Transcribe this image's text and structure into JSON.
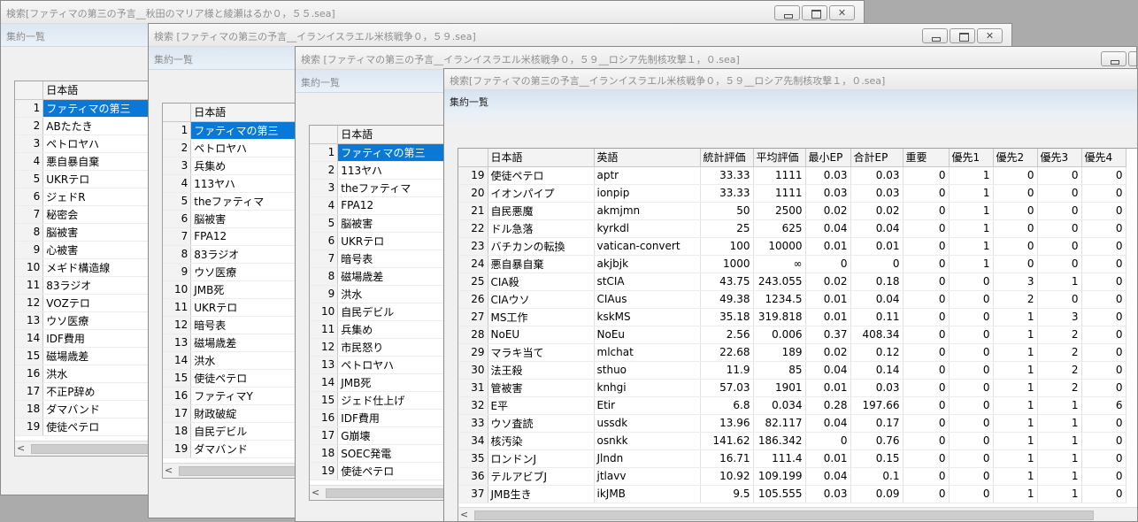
{
  "windows": {
    "w1": {
      "title": "検索[ファティマの第三の予言__秋田のマリア様と綾瀬はるか０，５５.sea]",
      "subtitle": "集約一覧"
    },
    "w2": {
      "title": "検索 [ファティマの第三の予言__イランイスラエル米核戦争０，５９.sea]",
      "subtitle": "集約一覧"
    },
    "w3": {
      "title": "検索 [ファティマの第三の予言__イランイスラエル米核戦争０，５９__ロシア先制核攻撃１，０.sea]",
      "subtitle": "集約一覧"
    },
    "w4": {
      "title": "検索[ファティマの第三の予言__イランイスラエル米核戦争０，５９__ロシア先制核攻撃１，０.sea]",
      "subtitle": "集約一覧"
    }
  },
  "grid1": {
    "header": "日本語",
    "rows": [
      "ファティマの第三",
      "ABたたき",
      "ペトロヤハ",
      "悪自暴自棄",
      "UKRテロ",
      "ジェドR",
      "秘密会",
      "脳被害",
      "心被害",
      "メギド構造線",
      "83ラジオ",
      "VOZテロ",
      "ウソ医療",
      "IDF費用",
      "磁場歳差",
      "洪水",
      "不正P辞め",
      "ダマバンド",
      "使徒ペテロ"
    ]
  },
  "grid2": {
    "header": "日本語",
    "rows": [
      "ファティマの第三",
      "ペトロヤハ",
      "兵集め",
      "113ヤハ",
      "theファティマ",
      "脳被害",
      "FPA12",
      "83ラジオ",
      "ウソ医療",
      "JMB死",
      "UKRテロ",
      "暗号表",
      "磁場歳差",
      "洪水",
      "使徒ペテロ",
      "ファティマY",
      "財政破綻",
      "自民デビル",
      "ダマバンド"
    ]
  },
  "grid3": {
    "header": "日本語",
    "rows": [
      "ファティマの第三",
      "113ヤハ",
      "theファティマ",
      "FPA12",
      "脳被害",
      "UKRテロ",
      "暗号表",
      "磁場歳差",
      "洪水",
      "自民デビル",
      "兵集め",
      "市民怒り",
      "ペトロヤハ",
      "JMB死",
      "ジェド仕上げ",
      "IDF費用",
      "G崩壊",
      "SOEC発電",
      "使徒ペテロ"
    ]
  },
  "grid4": {
    "headers": [
      "日本語",
      "英語",
      "統計評価",
      "平均評価",
      "最小EP",
      "合計EP",
      "重要",
      "優先1",
      "優先2",
      "優先3",
      "優先4"
    ],
    "rows": [
      [
        "19",
        "使徒ペテロ",
        "aptr",
        "33.33",
        "1111",
        "0.03",
        "0.03",
        "0",
        "1",
        "0",
        "0",
        "0"
      ],
      [
        "20",
        "イオンパイプ",
        "ionpip",
        "33.33",
        "1111",
        "0.03",
        "0.03",
        "0",
        "1",
        "0",
        "0",
        "0"
      ],
      [
        "21",
        "自民悪魔",
        "akmjmn",
        "50",
        "2500",
        "0.02",
        "0.02",
        "0",
        "1",
        "0",
        "0",
        "0"
      ],
      [
        "22",
        "ドル急落",
        "kyrkdl",
        "25",
        "625",
        "0.04",
        "0.04",
        "0",
        "1",
        "0",
        "0",
        "0"
      ],
      [
        "23",
        "バチカンの転換",
        "vatican-convert",
        "100",
        "10000",
        "0.01",
        "0.01",
        "0",
        "1",
        "0",
        "0",
        "0"
      ],
      [
        "24",
        "悪自暴自棄",
        "akjbjk",
        "1000",
        "∞",
        "0",
        "0",
        "0",
        "1",
        "0",
        "0",
        "0"
      ],
      [
        "25",
        "CIA殺",
        "stCIA",
        "43.75",
        "243.055",
        "0.02",
        "0.18",
        "0",
        "0",
        "3",
        "1",
        "0"
      ],
      [
        "26",
        "CIAウソ",
        "CIAus",
        "49.38",
        "1234.5",
        "0.01",
        "0.04",
        "0",
        "0",
        "2",
        "0",
        "0"
      ],
      [
        "27",
        "MS工作",
        "kskMS",
        "35.18",
        "319.818",
        "0.01",
        "0.11",
        "0",
        "0",
        "1",
        "3",
        "0"
      ],
      [
        "28",
        "NoEU",
        "NoEu",
        "2.56",
        "0.006",
        "0.37",
        "408.34",
        "0",
        "0",
        "1",
        "2",
        "0"
      ],
      [
        "29",
        "マラキ当て",
        "mlchat",
        "22.68",
        "189",
        "0.02",
        "0.12",
        "0",
        "0",
        "1",
        "2",
        "0"
      ],
      [
        "30",
        "法王殺",
        "sthuo",
        "11.9",
        "85",
        "0.04",
        "0.14",
        "0",
        "0",
        "1",
        "2",
        "0"
      ],
      [
        "31",
        "管被害",
        "knhgi",
        "57.03",
        "1901",
        "0.01",
        "0.03",
        "0",
        "0",
        "1",
        "2",
        "0"
      ],
      [
        "32",
        "E平",
        "Etir",
        "6.8",
        "0.034",
        "0.28",
        "197.66",
        "0",
        "0",
        "1",
        "1",
        "6"
      ],
      [
        "33",
        "ウソ査読",
        "ussdk",
        "13.96",
        "82.117",
        "0.04",
        "0.17",
        "0",
        "0",
        "1",
        "1",
        "0"
      ],
      [
        "34",
        "核汚染",
        "osnkk",
        "141.62",
        "186.342",
        "0",
        "0.76",
        "0",
        "0",
        "1",
        "1",
        "0"
      ],
      [
        "35",
        "ロンドンJ",
        "Jlndn",
        "16.71",
        "111.4",
        "0.01",
        "0.15",
        "0",
        "0",
        "1",
        "1",
        "0"
      ],
      [
        "36",
        "テルアビブJ",
        "jtlavv",
        "10.92",
        "109.199",
        "0.04",
        "0.1",
        "0",
        "0",
        "1",
        "1",
        "0"
      ],
      [
        "37",
        "JMB生き",
        "ikJMB",
        "9.5",
        "105.555",
        "0.03",
        "0.09",
        "0",
        "0",
        "1",
        "1",
        "0"
      ]
    ]
  }
}
